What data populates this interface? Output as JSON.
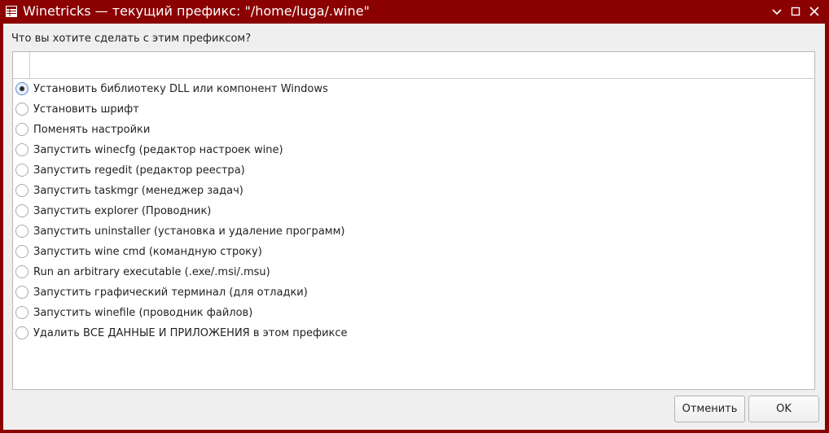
{
  "window": {
    "title": "Winetricks — текущий префикс: \"/home/luga/.wine\"",
    "icon": "app-window-icon",
    "controls": [
      "minimize-icon",
      "maximize-icon",
      "close-icon"
    ],
    "accent_color": "#8b0000"
  },
  "dialog": {
    "question": "Что вы хотите сделать с этим префиксом?",
    "options": [
      {
        "label": "Установить библиотеку DLL или компонент Windows",
        "selected": true
      },
      {
        "label": "Установить шрифт",
        "selected": false
      },
      {
        "label": "Поменять настройки",
        "selected": false
      },
      {
        "label": "Запустить winecfg (редактор настроек wine)",
        "selected": false
      },
      {
        "label": "Запустить regedit (редактор реестра)",
        "selected": false
      },
      {
        "label": "Запустить taskmgr (менеджер задач)",
        "selected": false
      },
      {
        "label": "Запустить explorer (Проводник)",
        "selected": false
      },
      {
        "label": "Запустить uninstaller (установка и удаление программ)",
        "selected": false
      },
      {
        "label": "Запустить wine cmd (командную строку)",
        "selected": false
      },
      {
        "label": "Run an arbitrary executable (.exe/.msi/.msu)",
        "selected": false
      },
      {
        "label": "Запустить графический терминал (для отладки)",
        "selected": false
      },
      {
        "label": "Запустить winefile (проводник файлов)",
        "selected": false
      },
      {
        "label": "Удалить ВСЕ ДАННЫЕ И ПРИЛОЖЕНИЯ в этом префиксе",
        "selected": false
      }
    ]
  },
  "buttons": {
    "cancel": "Отменить",
    "ok": "OK"
  }
}
